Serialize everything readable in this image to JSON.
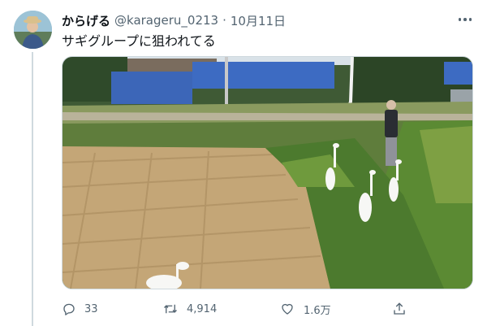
{
  "tweet": {
    "display_name": "からげる",
    "handle": "@karageru_0213",
    "separator": "·",
    "date": "10月11日",
    "text": "サギグループに狙われてる"
  },
  "actions": {
    "reply_count": "33",
    "retweet_count": "4,914",
    "like_count": "1.6万"
  },
  "icons": {
    "more": "more-horizontal-icon",
    "reply": "reply-icon",
    "retweet": "retweet-icon",
    "like": "heart-icon",
    "share": "share-icon"
  },
  "colors": {
    "text_primary": "#0f1419",
    "text_secondary": "#536471",
    "divider": "#cfd9de"
  }
}
